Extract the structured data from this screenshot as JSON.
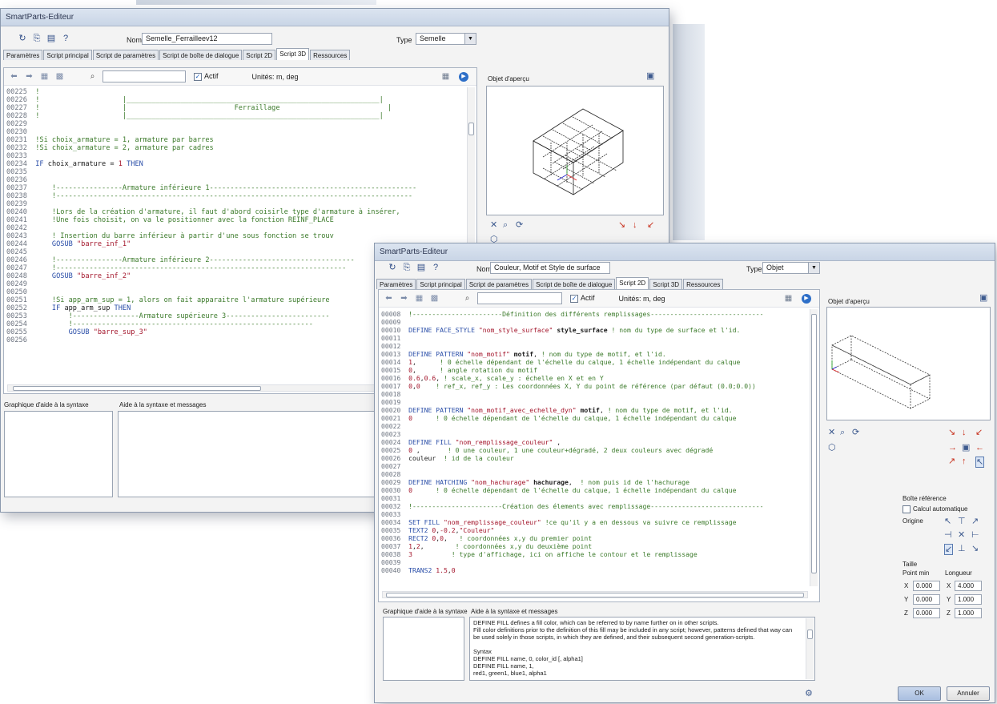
{
  "window1": {
    "title": "SmartParts-Editeur",
    "name_label": "Nom",
    "name_value": "Semelle_Ferrailleev12",
    "type_label": "Type",
    "type_value": "Semelle",
    "tabs": [
      "Paramètres",
      "Script principal",
      "Script de paramètres",
      "Script de boîte de dialogue",
      "Script 2D",
      "Script 3D",
      "Ressources"
    ],
    "active_tab": "Script 3D",
    "actif_label": "Actif",
    "units_label": "Unités: m, deg",
    "preview_label": "Objet d'aperçu",
    "syntax_graphic_label": "Graphique d'aide à la syntaxe",
    "syntax_messages_label": "Aide à la syntaxe et messages"
  },
  "window2": {
    "title": "SmartParts-Editeur",
    "name_label": "Nom",
    "name_value": "Couleur, Motif et Style de surface",
    "type_label": "Type",
    "type_value": "Objet",
    "tabs": [
      "Paramètres",
      "Script principal",
      "Script de paramètres",
      "Script de boîte de dialogue",
      "Script 2D",
      "Script 3D",
      "Ressources"
    ],
    "active_tab": "Script 2D",
    "actif_label": "Actif",
    "units_label": "Unités: m, deg",
    "preview_label": "Objet d'aperçu",
    "syntax_graphic_label": "Graphique d'aide à la syntaxe",
    "syntax_messages_label": "Aide à la syntaxe et messages",
    "help_text": [
      "DEFINE FILL defines a fill color, which can be referred to by name further on in other scripts.",
      "Fill color definitions prior to the definition of this fill may be included in any script; however, patterns defined that way can",
      "be used solely in those scripts, in which they are defined, and their subsequent second generation-scripts.",
      "",
      "Syntax",
      "DEFINE FILL name, 0, color_id [, alpha1]",
      "DEFINE FILL name, 1,",
      "red1, green1, blue1, alpha1"
    ],
    "boite_reference_label": "Boîte référence",
    "calcul_auto_label": "Calcul automatique",
    "origine_label": "Origine",
    "taille_label": "Taille",
    "point_min_label": "Point min",
    "longueur_label": "Longueur",
    "point_min": {
      "x_label": "X",
      "x": "0.000",
      "y_label": "Y",
      "y": "0.000",
      "z_label": "Z",
      "z": "0.000"
    },
    "longueur": {
      "x_label": "X",
      "x": "4.000",
      "y_label": "Y",
      "y": "1.000",
      "z_label": "Z",
      "z": "1.000"
    },
    "ok_label": "OK",
    "cancel_label": "Annuler"
  },
  "icons": {
    "undo": "undo-icon",
    "redo": "redo-icon",
    "insert": "insert-icon",
    "search": "search-icon",
    "run": "run-icon",
    "zoom-fit": "zoom-fit-icon",
    "zoom": "zoom-icon",
    "orbit": "orbit-icon",
    "settings": "gear-icon"
  },
  "colors": {
    "keyword": "#2a4ea8",
    "comment": "#3b7a2a",
    "string": "#a3142a",
    "ok_button": "#b7c9e6"
  }
}
